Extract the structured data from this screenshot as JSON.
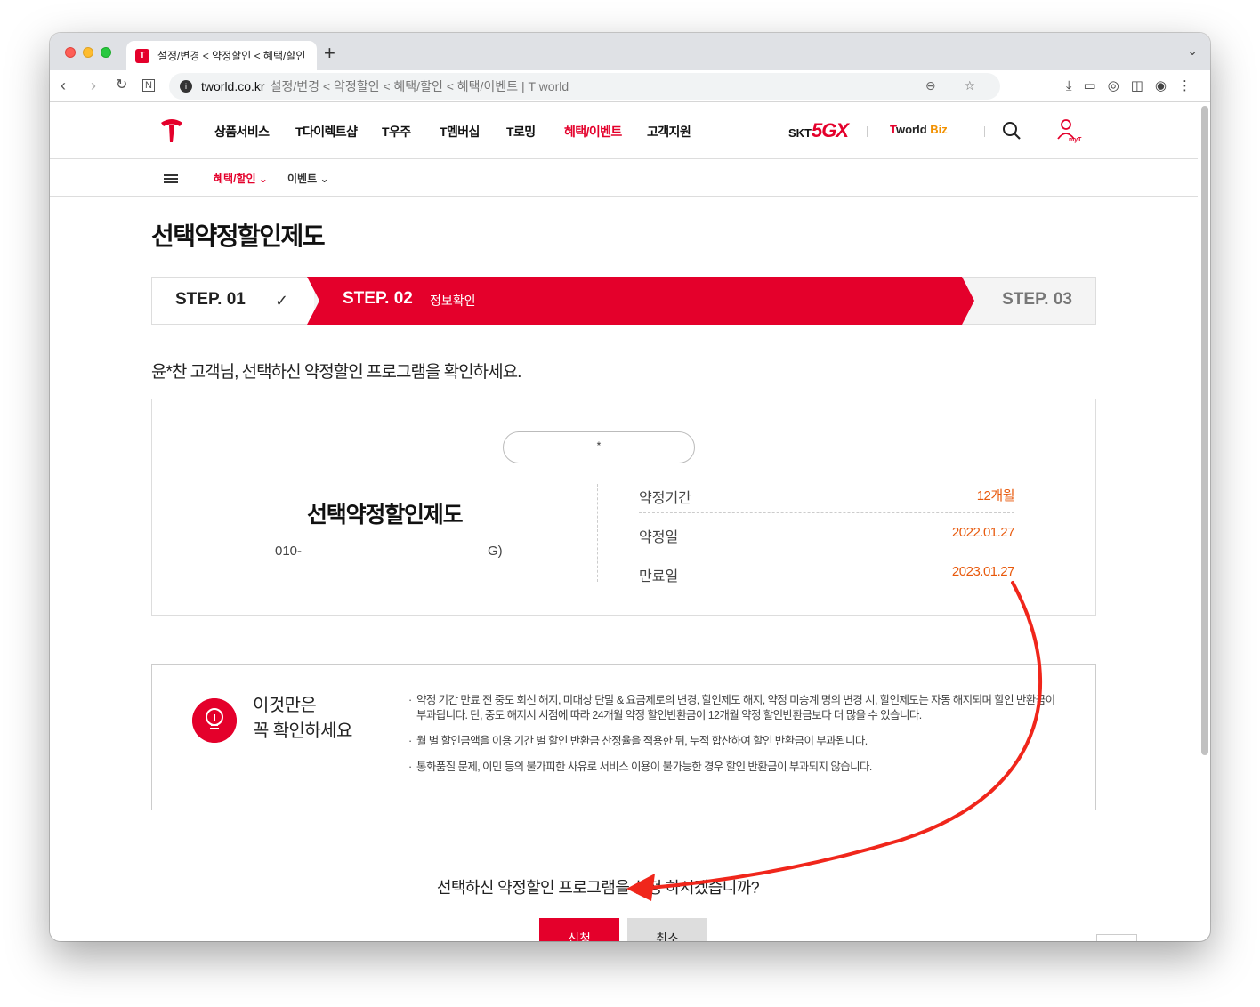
{
  "browser": {
    "tab_title": "설정/변경 < 약정할인 < 혜택/할인 <",
    "url_domain": "tworld.co.kr",
    "url_path": "설정/변경 < 약정할인 < 혜택/할인 < 혜택/이벤트 | T world"
  },
  "gnb": {
    "items": [
      "상품서비스",
      "T다이렉트샵",
      "T우주",
      "T멤버십",
      "T로밍",
      "혜택/이벤트",
      "고객지원"
    ],
    "active": "혜택/이벤트",
    "skt": "SKT",
    "fiveg": "5GX",
    "tworld": "world",
    "biz": "Biz",
    "myt": "myT"
  },
  "lnb": {
    "items": [
      "혜택/할인",
      "이벤트"
    ]
  },
  "page_title": "선택약정할인제도",
  "steps": {
    "step1": "STEP. 01",
    "step2": "STEP. 02",
    "step2_sub": "정보확인",
    "step3": "STEP. 03"
  },
  "greeting": "윤*찬 고객님, 선택하신 약정할인 프로그램을 확인하세요.",
  "info": {
    "pill_text": "*",
    "program_name": "선택약정할인제도",
    "phone_prefix": "010-",
    "phone_suffix": "G)",
    "rows": [
      {
        "label": "약정기간",
        "value": "12개월"
      },
      {
        "label": "약정일",
        "value": "2022.01.27"
      },
      {
        "label": "만료일",
        "value": "2023.01.27"
      }
    ]
  },
  "notice": {
    "title_line1": "이것만은",
    "title_line2": "꼭 확인하세요",
    "items": [
      "약정 기간 만료 전 중도 회선 해지, 미대상 단말 & 요금제로의 변경, 할인제도 해지, 약정 미승계 명의 변경 시, 할인제도는 자동 해지되며 할인 반환금이 부과됩니다. 단, 중도 해지시 시점에 따라 24개월 약정 할인반환금이 12개월 약정 할인반환금보다 더 많을 수 있습니다.",
      "월 별 할인금액을 이용 기간 별 할인 반환금 산정율을 적용한 뒤, 누적 합산하여 할인 반환금이 부과됩니다.",
      "통화품질 문제, 이민 등의 불가피한 사유로 서비스 이용이 불가능한 경우 할인 반환금이 부과되지 않습니다."
    ]
  },
  "question": "선택하신 약정할인 프로그램을 신청 하시겠습니까?",
  "buttons": {
    "apply": "신청",
    "cancel": "취소"
  },
  "colors": {
    "brand_red": "#e4002b",
    "value_orange": "#e8590c",
    "annotation_arrow": "#f0261b"
  }
}
